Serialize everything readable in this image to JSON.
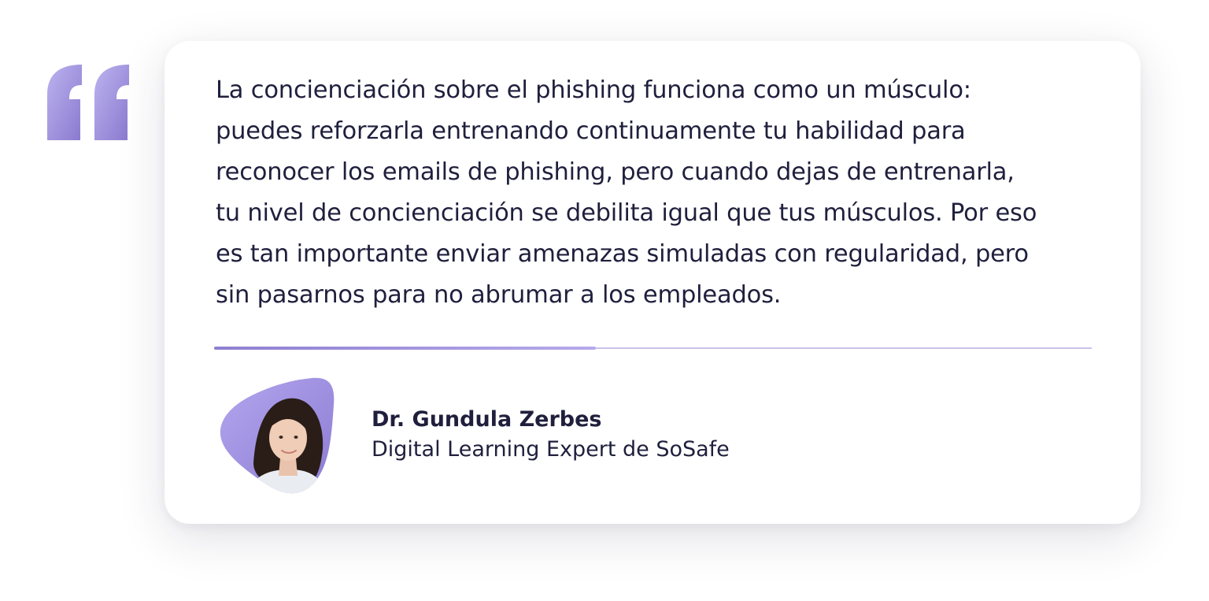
{
  "quote": {
    "lines": [
      "La concienciación sobre el phishing funciona como un músculo:",
      "puedes reforzarla entrenando continuamente tu habilidad para",
      "reconocer los emails de phishing, pero cuando dejas de entrenarla,",
      "tu nivel de concienciación se debilita igual que tus músculos. Por eso",
      "es tan importante enviar amenazas simuladas con regularidad, pero",
      "sin pasarnos para  no abrumar a los empleados."
    ]
  },
  "divider": {
    "progress_fraction": 0.435
  },
  "author": {
    "name": "Dr. Gundula Zerbes",
    "role": "Digital Learning Expert de SoSafe"
  },
  "colors": {
    "accent": "#8e7fd1",
    "accent_light": "#c9c2ec",
    "text": "#1f1f3d",
    "card_background": "#ffffff"
  },
  "icons": {
    "quote_mark": "opening-quote-icon"
  }
}
